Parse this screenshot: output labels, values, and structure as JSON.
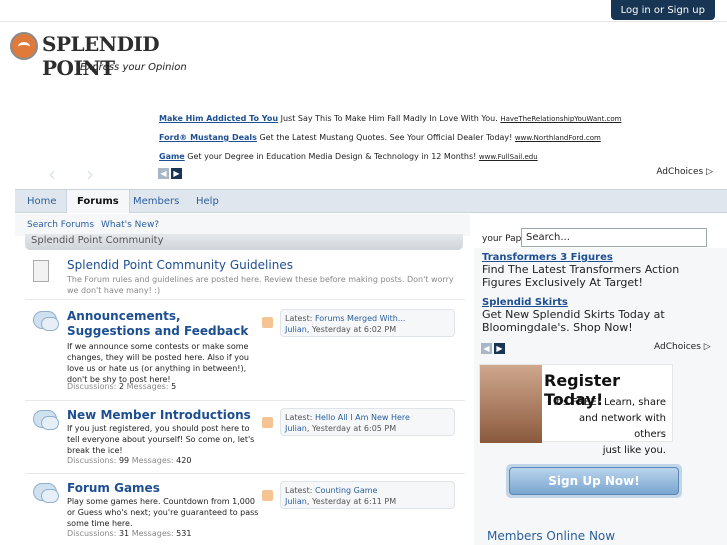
{
  "topbar": {
    "login_label": "Log in or Sign up"
  },
  "logo": {
    "name": "SPLENDID POINT",
    "tagline": "Express your Opinion"
  },
  "top_ads": [
    {
      "title": "Make Him Addicted To You",
      "desc": "Just Say This To Make Him Fall Madly In Love With You.",
      "url": "HaveTheRelationshipYouWant.com"
    },
    {
      "title": "Ford® Mustang Deals",
      "desc": "Get the Latest Mustang Quotes. See Your Official Dealer Today!",
      "url": "www.NorthlandFord.com"
    },
    {
      "title": "Game",
      "desc": "Get your Degree in Education Media Design & Technology in 12 Months!",
      "url": "www.FullSail.edu"
    }
  ],
  "adchoices_label": "AdChoices",
  "nav": {
    "items": [
      "Home",
      "Forums",
      "Members",
      "Help"
    ],
    "active": "Forums"
  },
  "subnav": {
    "items": [
      "Search Forums",
      "What's New?"
    ]
  },
  "search": {
    "value": "Search..."
  },
  "category": {
    "title": "Splendid Point Community"
  },
  "forums": [
    {
      "title": "Splendid Point Community Guidelines",
      "desc": "The Forum rules and guidelines are posted here. Review these before making posts. Don't worry we don't have many! :)"
    },
    {
      "title": "Announcements, Suggestions and Feedback",
      "desc": "If we announce some contests or make some changes, they will be posted here. Also if you love us or hate us (or anything in between!), don't be shy to post here!",
      "stats": {
        "disc_label": "Discussions:",
        "disc": "2",
        "msg_label": "Messages:",
        "msg": "5"
      },
      "latest": {
        "label": "Latest:",
        "thread": "Forums Merged With...",
        "user": "Julian",
        "time": "Yesterday at 6:02 PM"
      }
    },
    {
      "title": "New Member Introductions",
      "desc": "If you just registered, you should post here to tell everyone about yourself! So come on, let's break the ice!",
      "stats": {
        "disc_label": "Discussions:",
        "disc": "99",
        "msg_label": "Messages:",
        "msg": "420"
      },
      "latest": {
        "label": "Latest:",
        "thread": "Hello All I Am New Here",
        "user": "Julian",
        "time": "Yesterday at 6:05 PM"
      }
    },
    {
      "title": "Forum Games",
      "desc": "Play some games here. Countdown from 1,000 or Guess who's next; you're guaranteed to pass some time here.",
      "stats": {
        "disc_label": "Discussions:",
        "disc": "31",
        "msg_label": "Messages:",
        "msg": "531"
      },
      "latest": {
        "label": "Latest:",
        "thread": "Counting Game",
        "user": "Julian",
        "time": "Yesterday at 6:11 PM"
      }
    }
  ],
  "side_ads": {
    "cutoff_text": "your Pap",
    "items": [
      {
        "title": "Transformers 3 Figures",
        "desc": "Find The Latest Transformers Action Figures Exclusively At Target!"
      },
      {
        "title": "Splendid Skirts",
        "desc": "Get New Splendid Skirts Today at Bloomingdale's. Shop Now!"
      }
    ]
  },
  "register_banner": {
    "title": "Register Today!",
    "line1": "It's FREE! Learn, share",
    "line2": "and network with others",
    "line3": "just like you."
  },
  "signup_label": "Sign Up Now!",
  "members_online_label": "Members Online Now",
  "colors": {
    "brand_dark": "#183654",
    "link": "#2b5f9c",
    "nav_bg": "#dfe6ee"
  },
  "icons": [
    "forum-bubble-icon",
    "doc-icon",
    "rss-icon",
    "arrow-left-icon",
    "arrow-right-icon",
    "adchoices-icon"
  ]
}
